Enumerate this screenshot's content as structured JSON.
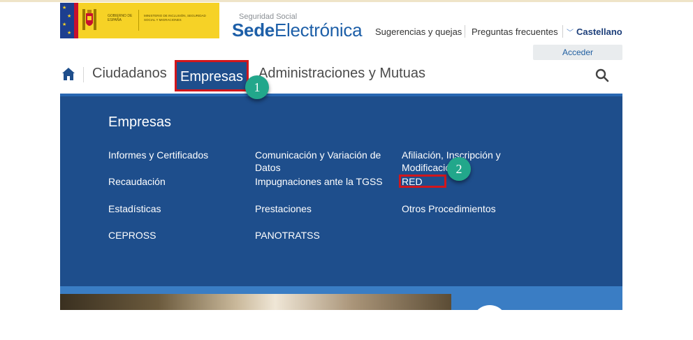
{
  "header": {
    "gov_logo": {
      "gobierno": "GOBIERNO DE ESPAÑA",
      "ministerio": "MINISTERIO DE INCLUSIÓN, SEGURIDAD SOCIAL Y MIGRACIONES"
    },
    "sede": {
      "small": "Seguridad Social",
      "bold": "Sede",
      "light": "Electrónica"
    },
    "links": {
      "sugerencias": "Sugerencias y quejas",
      "preguntas": "Preguntas frecuentes",
      "language": "Castellano"
    },
    "acceder": "Acceder"
  },
  "nav": {
    "ciudadanos": "Ciudadanos",
    "empresas": "Empresas",
    "administraciones": "Administraciones y Mutuas"
  },
  "mega_menu": {
    "title": "Empresas",
    "col1": [
      "Informes y Certificados",
      "Recaudación",
      "Estadísticas",
      "CEPROSS"
    ],
    "col2": [
      "Comunicación y Variación de Datos",
      "Impugnaciones ante la TGSS",
      "Prestaciones",
      "PANOTRATSS"
    ],
    "col3": [
      "Afiliación, Inscripción y Modificación",
      "RED",
      "Otros Procedimientos"
    ]
  },
  "annotations": {
    "step1": "1",
    "step2": "2"
  },
  "colors": {
    "brand_blue": "#1e4e8c",
    "highlight_red": "#d1161c",
    "badge_green": "#22a78b"
  }
}
